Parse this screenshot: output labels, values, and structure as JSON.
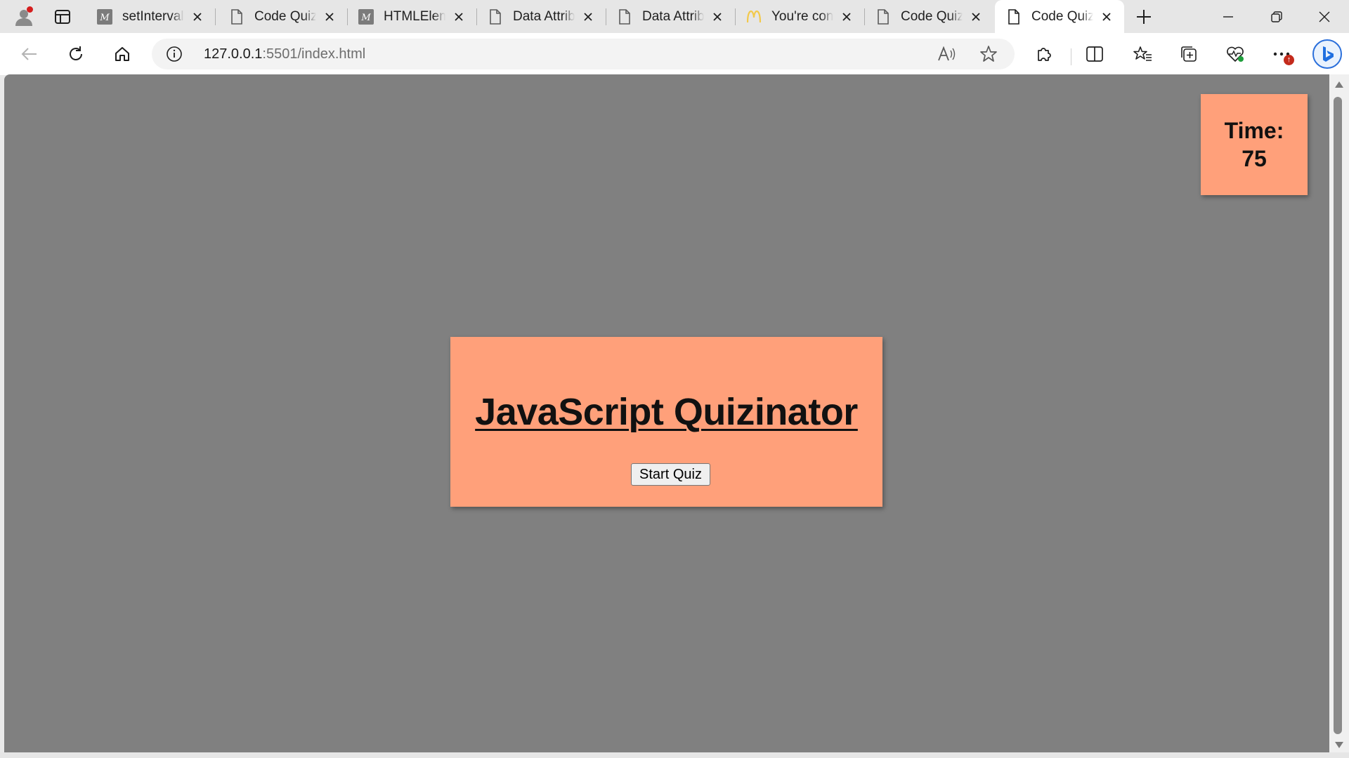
{
  "browser": {
    "tabs": [
      {
        "title": "setInterval(",
        "icon": "mdn-icon"
      },
      {
        "title": "Code Quiz",
        "icon": "page-icon"
      },
      {
        "title": "HTMLElem",
        "icon": "mdn-icon"
      },
      {
        "title": "Data Attrib",
        "icon": "page-icon"
      },
      {
        "title": "Data Attrib",
        "icon": "page-icon"
      },
      {
        "title": "You're con",
        "icon": "mcdonalds-icon"
      },
      {
        "title": "Code Quiz",
        "icon": "page-icon"
      },
      {
        "title": "Code Quiz",
        "icon": "page-icon",
        "active": true
      }
    ],
    "address": {
      "host": "127.0.0.1",
      "path": ":5501/index.html"
    },
    "badge_glyph": "↑",
    "colors": {
      "page_background": "#808080",
      "panel_background": "#ffa07a",
      "badge": "#c42b1c"
    }
  },
  "page": {
    "timer": {
      "label": "Time:",
      "value": "75"
    },
    "title": "JavaScript Quizinator",
    "start_button": "Start Quiz"
  }
}
